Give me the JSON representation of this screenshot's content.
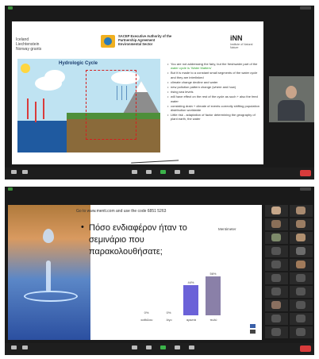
{
  "window1": {
    "slide": {
      "logo_left": "Iceland Liechtenstein Norway grants",
      "logo_center": "SACEP Executive Authority of the Partnership Agreement Environmental Sector",
      "logo_right": "iNN",
      "logo_right_sub": "Institute of Natural Nature",
      "diagram_title": "Hydrologic Cycle",
      "bullets": [
        "You are not addressing the fairy, but the freshwater part of the water cycle is 'Water Matters'",
        "But it is made to a constant small segments of the water cycle and they are interlinked",
        "climate change decline and water",
        "new pollution pattern change (where and how)",
        "rising sea levels",
        "will have effect on the rest of the cycle as such + also the feed water",
        "consisting drain + climate of events correctly shifting population distribution worldwide",
        "Little risk - adaptation of factor determining the geography of plant earth, the water"
      ],
      "highlight": "water cycle is 'Water Matters'"
    },
    "toolbar": {
      "leave_color": "#d83b3b"
    }
  },
  "window2": {
    "slide": {
      "code_text": "Go to www.menti.com and use the code 6851 5263",
      "bullet": "•",
      "question": "Πόσο ενδιαφέρον ήταν το σεμινάριο που παρακολουθήσατε;",
      "brand": "Mentimeter"
    },
    "gallery": [
      {
        "name": "",
        "color": "#c6a78a"
      },
      {
        "name": "",
        "color": "#a88a70"
      },
      {
        "name": "",
        "color": "#8a6f58"
      },
      {
        "name": "",
        "color": "#9b7d63"
      },
      {
        "name": "",
        "color": "#7d8a6a"
      },
      {
        "name": "",
        "color": "#b09070"
      },
      {
        "name": "",
        "color": "#555555"
      },
      {
        "name": "",
        "color": "#6c6c6c"
      },
      {
        "name": "",
        "color": "#555555"
      },
      {
        "name": "",
        "color": "#a07a5a"
      },
      {
        "name": "",
        "color": "#555555"
      },
      {
        "name": "",
        "color": "#555555"
      },
      {
        "name": "",
        "color": "#555555"
      },
      {
        "name": "",
        "color": "#555555"
      },
      {
        "name": "",
        "color": "#8a7060"
      },
      {
        "name": "",
        "color": "#555555"
      },
      {
        "name": "",
        "color": "#555555"
      },
      {
        "name": "",
        "color": "#555555"
      },
      {
        "name": "",
        "color": "#555555"
      },
      {
        "name": "",
        "color": "#555555"
      }
    ]
  },
  "chart_data": {
    "type": "bar",
    "title": "Πόσο ενδιαφέρον ήταν το σεμινάριο που παρακολουθήσατε;",
    "categories": [
      "καθόλου",
      "λίγο",
      "αρκετά",
      "πολύ"
    ],
    "values": [
      0,
      0,
      44,
      56
    ],
    "value_labels": [
      "0%",
      "0%",
      "44%",
      "56%"
    ],
    "colors": [
      "#6b62d8",
      "#6b62d8",
      "#6b62d8",
      "#8a80a8"
    ],
    "ylim": [
      0,
      60
    ],
    "grid": false
  }
}
